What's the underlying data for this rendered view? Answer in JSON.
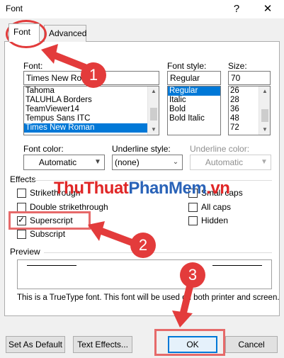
{
  "window": {
    "title": "Font",
    "help": "?",
    "close": "✕"
  },
  "tabs": [
    {
      "label": "Font",
      "active": true
    },
    {
      "label": "Advanced",
      "active": false
    }
  ],
  "font": {
    "label": "Font:",
    "value": "Times New Roman",
    "items": [
      "Tahoma",
      "TALUHLA Borders",
      "TeamViewer14",
      "Tempus Sans ITC",
      "Times New Roman"
    ],
    "selected": "Times New Roman"
  },
  "font_style": {
    "label": "Font style:",
    "value": "Regular",
    "items": [
      "Regular",
      "Italic",
      "Bold",
      "Bold Italic"
    ],
    "selected": "Regular"
  },
  "size": {
    "label": "Size:",
    "value": "70",
    "items": [
      "26",
      "28",
      "36",
      "48",
      "72"
    ]
  },
  "font_color": {
    "label": "Font color:",
    "value": "Automatic"
  },
  "underline_style": {
    "label": "Underline style:",
    "value": "(none)"
  },
  "underline_color": {
    "label": "Underline color:",
    "value": "Automatic"
  },
  "effects": {
    "label": "Effects",
    "left": [
      {
        "label": "Strikethrough",
        "checked": false
      },
      {
        "label": "Double strikethrough",
        "checked": false
      },
      {
        "label": "Superscript",
        "checked": true
      },
      {
        "label": "Subscript",
        "checked": false
      }
    ],
    "right": [
      {
        "label": "Small caps",
        "checked": false
      },
      {
        "label": "All caps",
        "checked": false
      },
      {
        "label": "Hidden",
        "checked": false
      }
    ]
  },
  "preview": {
    "label": "Preview",
    "note": "This is a TrueType font. This font will be used on both printer and screen."
  },
  "buttons": {
    "set_default": "Set As Default",
    "text_effects": "Text Effects...",
    "ok": "OK",
    "cancel": "Cancel"
  },
  "watermark": {
    "part1": "ThuThuat",
    "part2": "PhanMem",
    "part3": ".vn"
  },
  "annotations": {
    "step1": "1",
    "step2": "2",
    "step3": "3"
  },
  "colors": {
    "selection": "#0078d7",
    "annotation": "#e33b3b"
  }
}
